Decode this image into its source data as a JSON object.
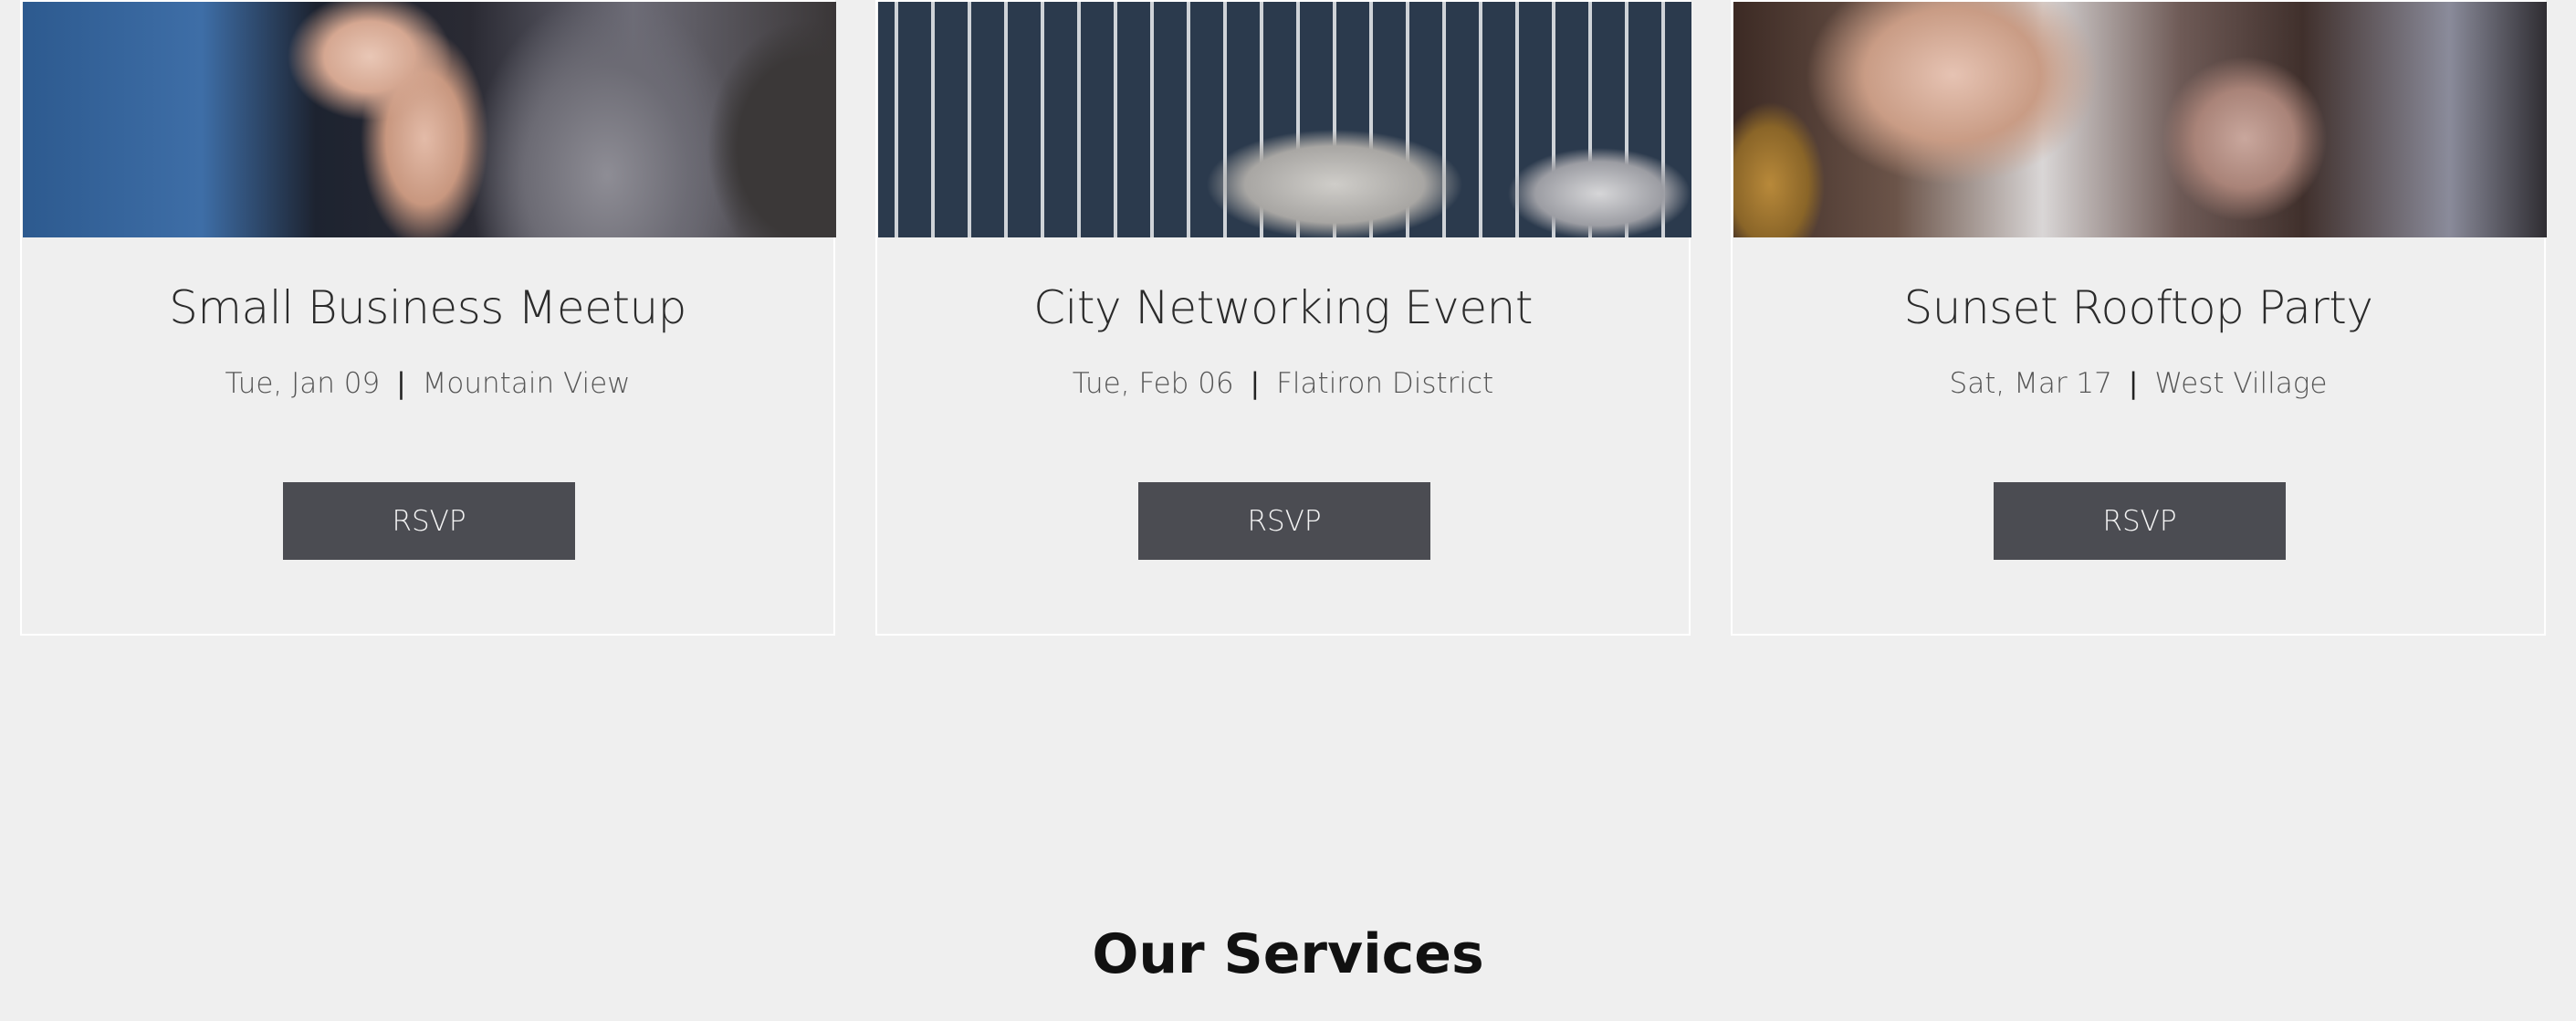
{
  "events": [
    {
      "title": "Small Business Meetup",
      "date": "Tue, Jan 09",
      "location": "Mountain View",
      "button_label": "RSVP",
      "image": "crowd-clapping-photo"
    },
    {
      "title": "City Networking Event",
      "date": "Tue, Feb 06",
      "location": "Flatiron District",
      "button_label": "RSVP",
      "image": "city-street-van-photo"
    },
    {
      "title": "Sunset Rooftop Party",
      "date": "Sat, Mar 17",
      "location": "West Village",
      "button_label": "RSVP",
      "image": "party-hands-photo"
    }
  ],
  "meta_separator": "|",
  "services": {
    "title": "Our Services"
  },
  "colors": {
    "background": "#efefef",
    "button": "#4b4c52",
    "card_border": "#ffffff"
  }
}
